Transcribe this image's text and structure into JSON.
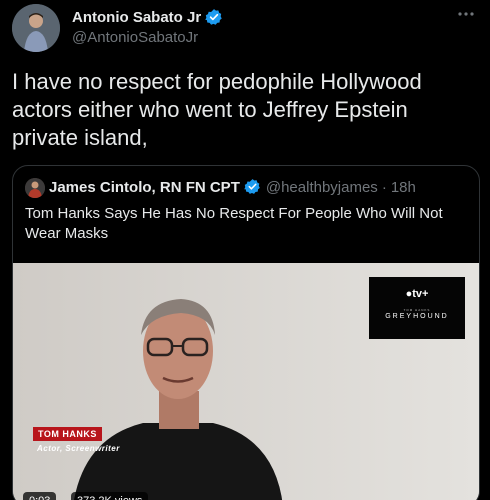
{
  "tweet": {
    "author_name": "Antonio Sabato Jr",
    "author_handle": "@AntonioSabatoJr",
    "text": "I have no respect for pedophile Hollywood actors either who went to Jeffrey Epstein private island,"
  },
  "quoted_tweet": {
    "author_name": "James Cintolo, RN FN CPT",
    "author_handle": "@healthbyjames",
    "separator": "·",
    "time": "18h",
    "text": "Tom Hanks Says He Has No Respect For People Who Will Not Wear Masks"
  },
  "video": {
    "brand": "tv+",
    "brand_sub": "TOM HANKS",
    "film_title": "GREYHOUND",
    "lower_third_name": "TOM HANKS",
    "lower_third_role": "Actor, Screenwriter",
    "duration": "0:03",
    "views": "373.2K views"
  },
  "icons": {
    "verified": "verified-badge-icon",
    "more": "more-options-icon",
    "apple": "apple-logo-icon"
  },
  "colors": {
    "background": "#000000",
    "text": "#e7e9ea",
    "muted": "#71767b",
    "verified": "#1d9bf0",
    "border": "#2f3336",
    "lower_third": "#b8151b"
  }
}
